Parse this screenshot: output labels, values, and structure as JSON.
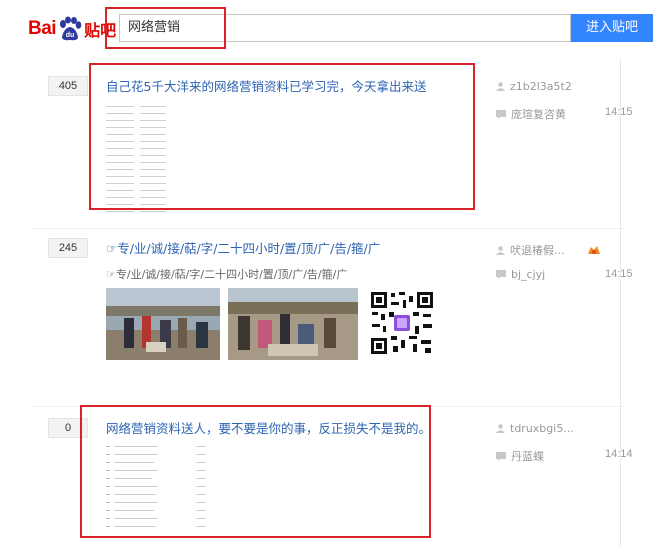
{
  "header": {
    "logo_bai": "Bai",
    "logo_tieba": "贴吧",
    "search_value": "网络营销",
    "search_button": "进入贴吧"
  },
  "threads": [
    {
      "reply_count": "405",
      "title": "自己花5千大洋来的网络营销资料已学习完，今天拿出来送",
      "author": "z1b2l3a5t2",
      "last_reply_user": "庞瑄复咨黄",
      "time": "14:15"
    },
    {
      "reply_count": "245",
      "title": "☞专/业/诚/接/萜/字/二十四小时/置/顶/广/告/箍/广",
      "excerpt": "☞专/业/诚/接/萜/字/二十四小时/置/顶/广/告/箍/广",
      "author": "吠退椿假...",
      "last_reply_user": "bj_cjyj",
      "time": "14:15"
    },
    {
      "reply_count": "0",
      "title": "网络营销资料送人，要不要是你的事，反正损失不是我的。",
      "author": "tdruxbgi5...",
      "last_reply_user": "丹蓝蝶",
      "time": "14:14"
    }
  ],
  "colors": {
    "brand_red": "#e10601",
    "link_blue": "#2d64b3",
    "button_blue": "#3385ff",
    "highlight_red": "#d9232b"
  }
}
